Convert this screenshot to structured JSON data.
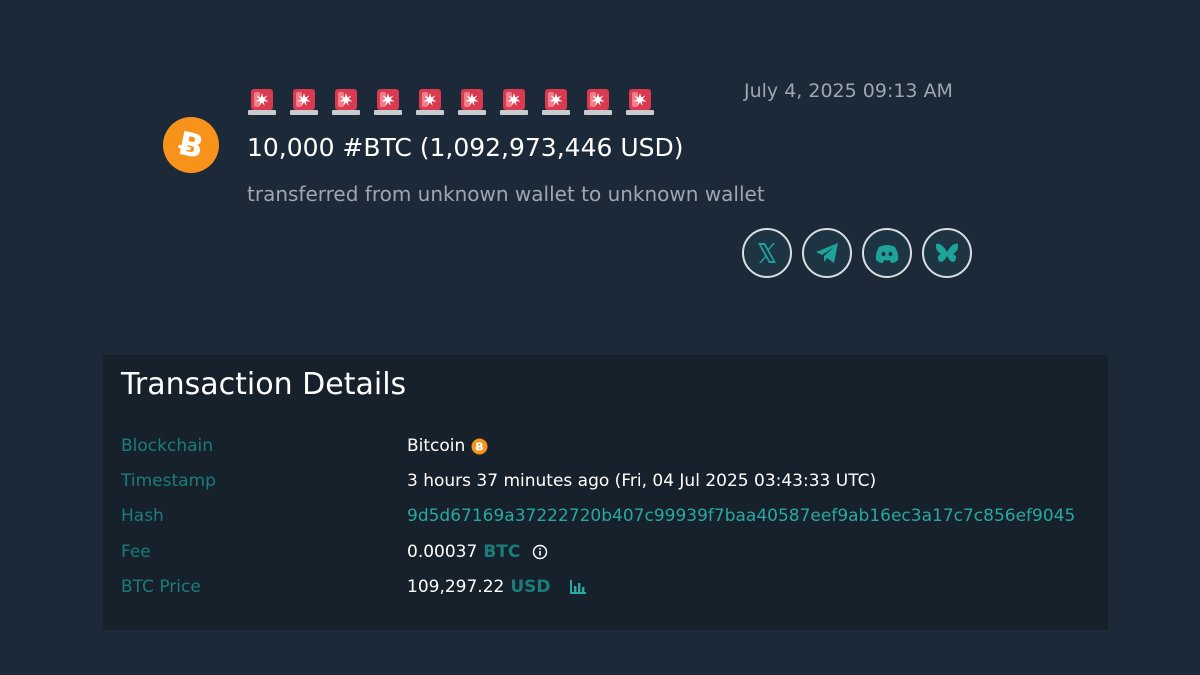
{
  "alert": {
    "siren_count": 10,
    "headline": "10,000 #BTC (1,092,973,446 USD)",
    "subline": "transferred from unknown wallet to unknown wallet",
    "date": "July 4, 2025 09:13 AM",
    "coin_logo_icon": "bitcoin-logo-icon",
    "siren_icon": "police-car-light-icon",
    "social_icons": [
      "x-icon",
      "telegram-icon",
      "discord-icon",
      "bluesky-icon"
    ]
  },
  "details": {
    "title": "Transaction Details",
    "rows": [
      {
        "label": "Blockchain",
        "value": "Bitcoin"
      },
      {
        "label": "Timestamp",
        "value": "3 hours 37 minutes ago (Fri, 04 Jul 2025 03:43:33 UTC)"
      },
      {
        "label": "Hash",
        "value": "9d5d67169a37222720b407c99939f7baa40587eef9ab16ec3a17c7c856ef9045"
      },
      {
        "label": "Fee",
        "value": "0.00037",
        "unit": "BTC"
      },
      {
        "label": "BTC Price",
        "value": "109,297.22",
        "unit": "USD"
      }
    ]
  },
  "colors": {
    "background": "#1c2938",
    "panel": "#16212c",
    "label_teal": "#1a7d7a",
    "link_teal": "#27a9a1",
    "bitcoin_orange": "#f7931a",
    "siren_red": "#d93a4f"
  }
}
